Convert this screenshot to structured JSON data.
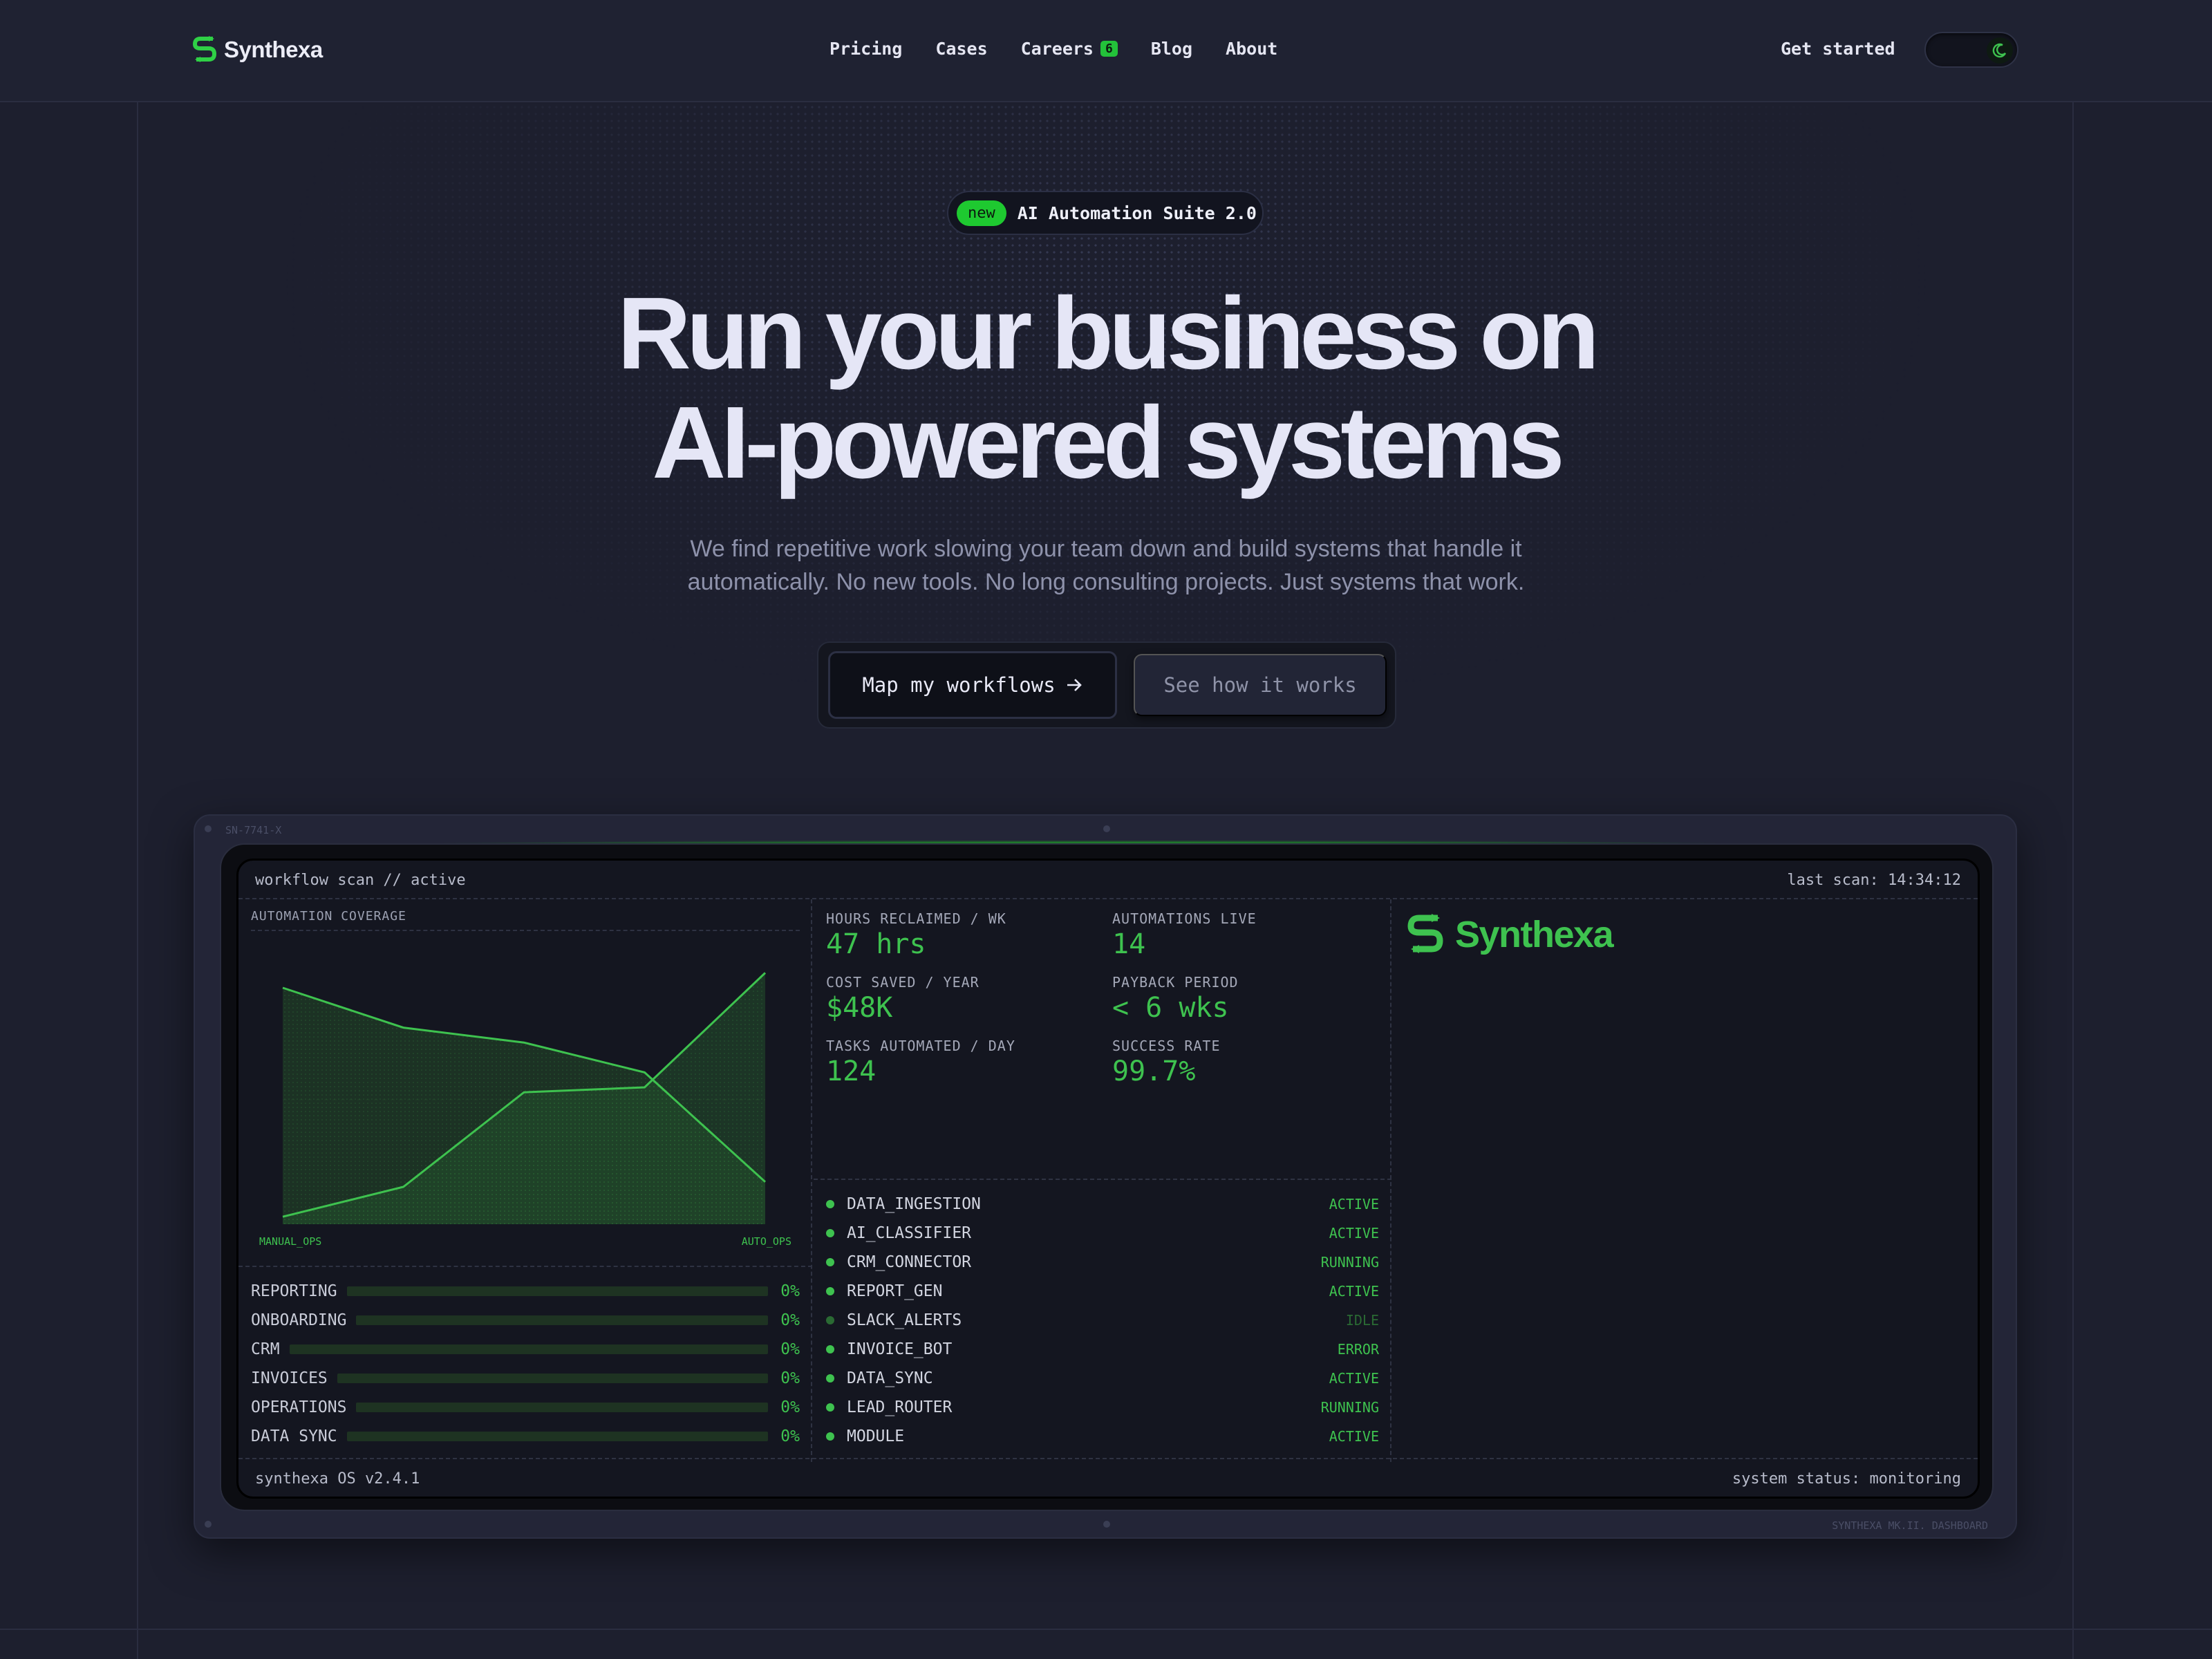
{
  "brand": {
    "name": "Synthexa",
    "accent": "#3ec24f"
  },
  "nav": {
    "links": [
      {
        "label": "Pricing"
      },
      {
        "label": "Cases"
      },
      {
        "label": "Careers",
        "badge": "6"
      },
      {
        "label": "Blog"
      },
      {
        "label": "About"
      }
    ],
    "cta": "Get started",
    "theme_toggle_icon": "moon-icon"
  },
  "hero": {
    "pill_tag": "new",
    "pill_text": "AI Automation Suite 2.0",
    "headline_line1": "Run your business on",
    "headline_line2": "AI-powered systems",
    "subhead_line1": "We find repetitive work slowing your team down and build systems that handle it",
    "subhead_line2": "automatically. No new tools. No long consulting projects. Just systems that work.",
    "primary_cta": "Map my workflows",
    "primary_cta_icon": "arrow-right-icon",
    "secondary_cta": "See how it works"
  },
  "device": {
    "serial": "SN-7741-X",
    "model": "SYNTHEXA MK.II. DASHBOARD",
    "screen_title": "workflow scan // active",
    "last_scan": "last scan: 14:34:12",
    "footer_left": "synthexa OS v2.4.1",
    "footer_right": "system status: monitoring"
  },
  "chart_data": {
    "type": "area",
    "title": "AUTOMATION COVERAGE",
    "xlabel_left": "MANUAL_OPS",
    "xlabel_right": "AUTO_OPS",
    "x": [
      0,
      1,
      2,
      3,
      4
    ],
    "ylim": [
      0,
      100
    ],
    "series": [
      {
        "name": "MANUAL_OPS",
        "values": [
          95,
          79,
          73,
          61,
          17
        ]
      },
      {
        "name": "AUTO_OPS",
        "values": [
          3,
          15,
          53,
          55,
          101
        ]
      }
    ]
  },
  "progress": [
    {
      "label": "REPORTING",
      "value": 0,
      "display": "0%"
    },
    {
      "label": "ONBOARDING",
      "value": 0,
      "display": "0%"
    },
    {
      "label": "CRM",
      "value": 0,
      "display": "0%"
    },
    {
      "label": "INVOICES",
      "value": 0,
      "display": "0%"
    },
    {
      "label": "OPERATIONS",
      "value": 0,
      "display": "0%"
    },
    {
      "label": "DATA SYNC",
      "value": 0,
      "display": "0%"
    }
  ],
  "metrics": [
    {
      "label": "HOURS RECLAIMED / WK",
      "value": "47 hrs"
    },
    {
      "label": "AUTOMATIONS LIVE",
      "value": "14"
    },
    {
      "label": "COST SAVED / YEAR",
      "value": "$48K"
    },
    {
      "label": "PAYBACK PERIOD",
      "value": "< 6 wks"
    },
    {
      "label": "TASKS AUTOMATED / DAY",
      "value": "124"
    },
    {
      "label": "SUCCESS RATE",
      "value": "99.7%"
    }
  ],
  "services": [
    {
      "name": "DATA_INGESTION",
      "status": "ACTIVE"
    },
    {
      "name": "AI_CLASSIFIER",
      "status": "ACTIVE"
    },
    {
      "name": "CRM_CONNECTOR",
      "status": "RUNNING"
    },
    {
      "name": "REPORT_GEN",
      "status": "ACTIVE"
    },
    {
      "name": "SLACK_ALERTS",
      "status": "IDLE"
    },
    {
      "name": "INVOICE_BOT",
      "status": "ERROR"
    },
    {
      "name": "DATA_SYNC",
      "status": "ACTIVE"
    },
    {
      "name": "LEAD_ROUTER",
      "status": "RUNNING"
    },
    {
      "name": "MODULE",
      "status": "ACTIVE"
    }
  ]
}
